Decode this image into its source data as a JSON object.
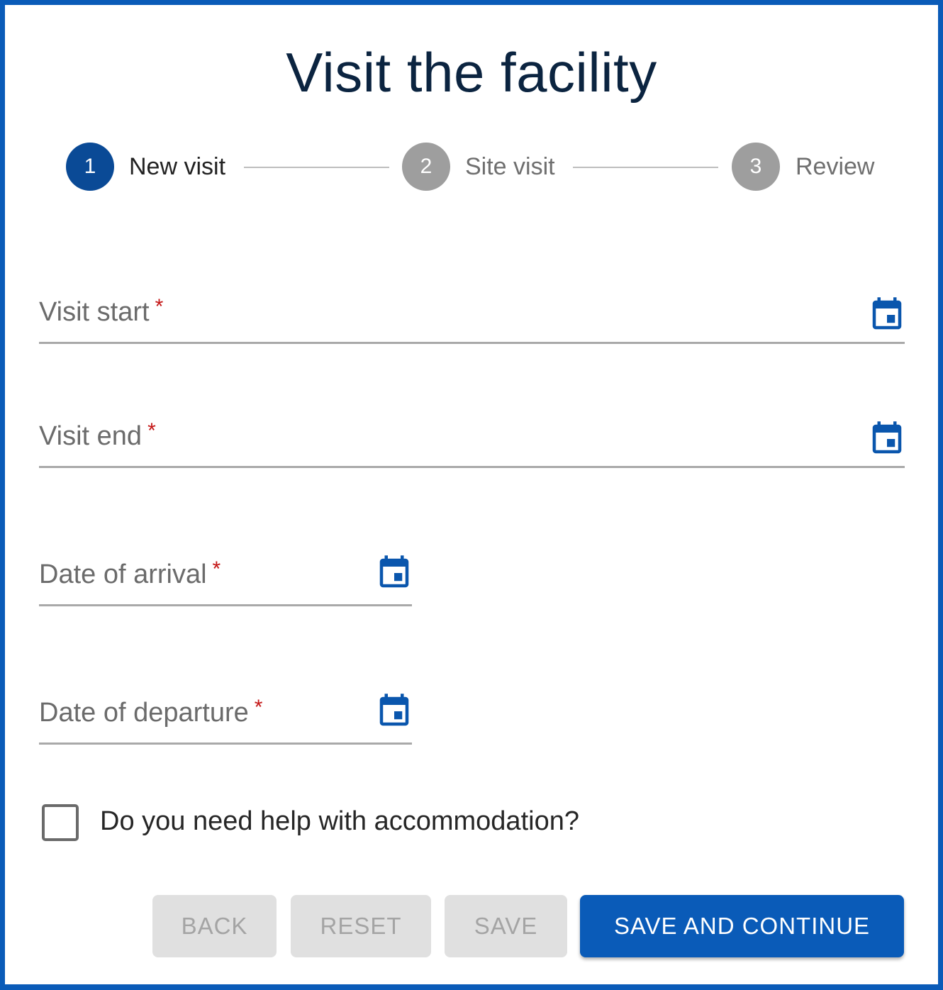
{
  "page": {
    "title": "Visit the facility"
  },
  "stepper": {
    "steps": [
      {
        "number": "1",
        "label": "New visit",
        "state": "active"
      },
      {
        "number": "2",
        "label": "Site visit",
        "state": "inactive"
      },
      {
        "number": "3",
        "label": "Review",
        "state": "inactive"
      }
    ]
  },
  "form": {
    "required_marker": "*",
    "fields": [
      {
        "label": "Visit start",
        "value": "",
        "required": true,
        "icon": "calendar-icon"
      },
      {
        "label": "Visit end",
        "value": "",
        "required": true,
        "icon": "calendar-icon"
      },
      {
        "label": "Date of arrival",
        "value": "",
        "required": true,
        "icon": "calendar-icon"
      },
      {
        "label": "Date of departure",
        "value": "",
        "required": true,
        "icon": "calendar-icon"
      }
    ],
    "accommodation_checkbox": {
      "label": "Do you need help with accommodation?",
      "checked": false
    }
  },
  "actions": {
    "back_label": "BACK",
    "reset_label": "RESET",
    "save_label": "SAVE",
    "save_continue_label": "SAVE AND CONTINUE"
  },
  "colors": {
    "brand_blue": "#0a5bb8",
    "active_step": "#0a4a96",
    "inactive_step": "#9e9e9e",
    "required": "#c41616",
    "title": "#0b2440"
  }
}
